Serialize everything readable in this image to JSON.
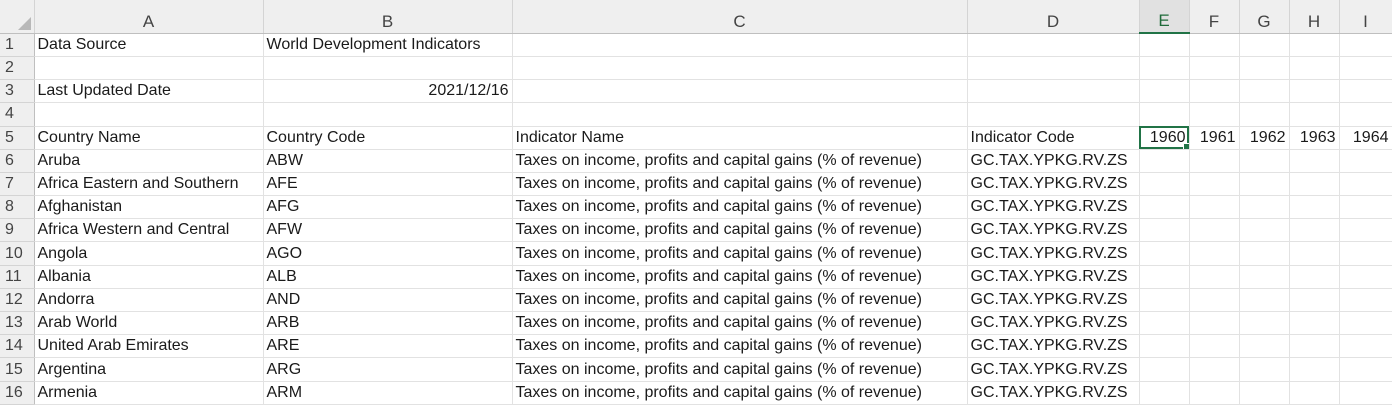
{
  "columns": [
    "A",
    "B",
    "C",
    "D",
    "E",
    "F",
    "G",
    "H",
    "I"
  ],
  "rows": [
    {
      "num": "1",
      "A": "Data Source",
      "B": "World Development Indicators",
      "C": "",
      "D": ""
    },
    {
      "num": "2",
      "A": "",
      "B": "",
      "C": "",
      "D": ""
    },
    {
      "num": "3",
      "A": "Last Updated Date",
      "B": "2021/12/16",
      "C": "",
      "D": ""
    },
    {
      "num": "4",
      "A": "",
      "B": "",
      "C": "",
      "D": ""
    },
    {
      "num": "5",
      "A": "Country Name",
      "B": "Country Code",
      "C": "Indicator Name",
      "D": "Indicator Code",
      "E": "1960",
      "F": "1961",
      "G": "1962",
      "H": "1963",
      "I": "1964"
    },
    {
      "num": "6",
      "A": "Aruba",
      "B": "ABW",
      "C": "Taxes on income, profits and capital gains (% of revenue)",
      "D": "GC.TAX.YPKG.RV.ZS"
    },
    {
      "num": "7",
      "A": "Africa Eastern and Southern",
      "B": "AFE",
      "C": "Taxes on income, profits and capital gains (% of revenue)",
      "D": "GC.TAX.YPKG.RV.ZS"
    },
    {
      "num": "8",
      "A": "Afghanistan",
      "B": "AFG",
      "C": "Taxes on income, profits and capital gains (% of revenue)",
      "D": "GC.TAX.YPKG.RV.ZS"
    },
    {
      "num": "9",
      "A": "Africa Western and Central",
      "B": "AFW",
      "C": "Taxes on income, profits and capital gains (% of revenue)",
      "D": "GC.TAX.YPKG.RV.ZS"
    },
    {
      "num": "10",
      "A": "Angola",
      "B": "AGO",
      "C": "Taxes on income, profits and capital gains (% of revenue)",
      "D": "GC.TAX.YPKG.RV.ZS"
    },
    {
      "num": "11",
      "A": "Albania",
      "B": "ALB",
      "C": "Taxes on income, profits and capital gains (% of revenue)",
      "D": "GC.TAX.YPKG.RV.ZS"
    },
    {
      "num": "12",
      "A": "Andorra",
      "B": "AND",
      "C": "Taxes on income, profits and capital gains (% of revenue)",
      "D": "GC.TAX.YPKG.RV.ZS"
    },
    {
      "num": "13",
      "A": "Arab World",
      "B": "ARB",
      "C": "Taxes on income, profits and capital gains (% of revenue)",
      "D": "GC.TAX.YPKG.RV.ZS"
    },
    {
      "num": "14",
      "A": "United Arab Emirates",
      "B": "ARE",
      "C": "Taxes on income, profits and capital gains (% of revenue)",
      "D": "GC.TAX.YPKG.RV.ZS"
    },
    {
      "num": "15",
      "A": "Argentina",
      "B": "ARG",
      "C": "Taxes on income, profits and capital gains (% of revenue)",
      "D": "GC.TAX.YPKG.RV.ZS"
    },
    {
      "num": "16",
      "A": "Armenia",
      "B": "ARM",
      "C": "Taxes on income, profits and capital gains (% of revenue)",
      "D": "GC.TAX.YPKG.RV.ZS"
    }
  ],
  "selected_cell": "E5",
  "colors": {
    "header_bg": "#efefef",
    "gridline": "#e2e2e2",
    "selection": "#217346"
  }
}
